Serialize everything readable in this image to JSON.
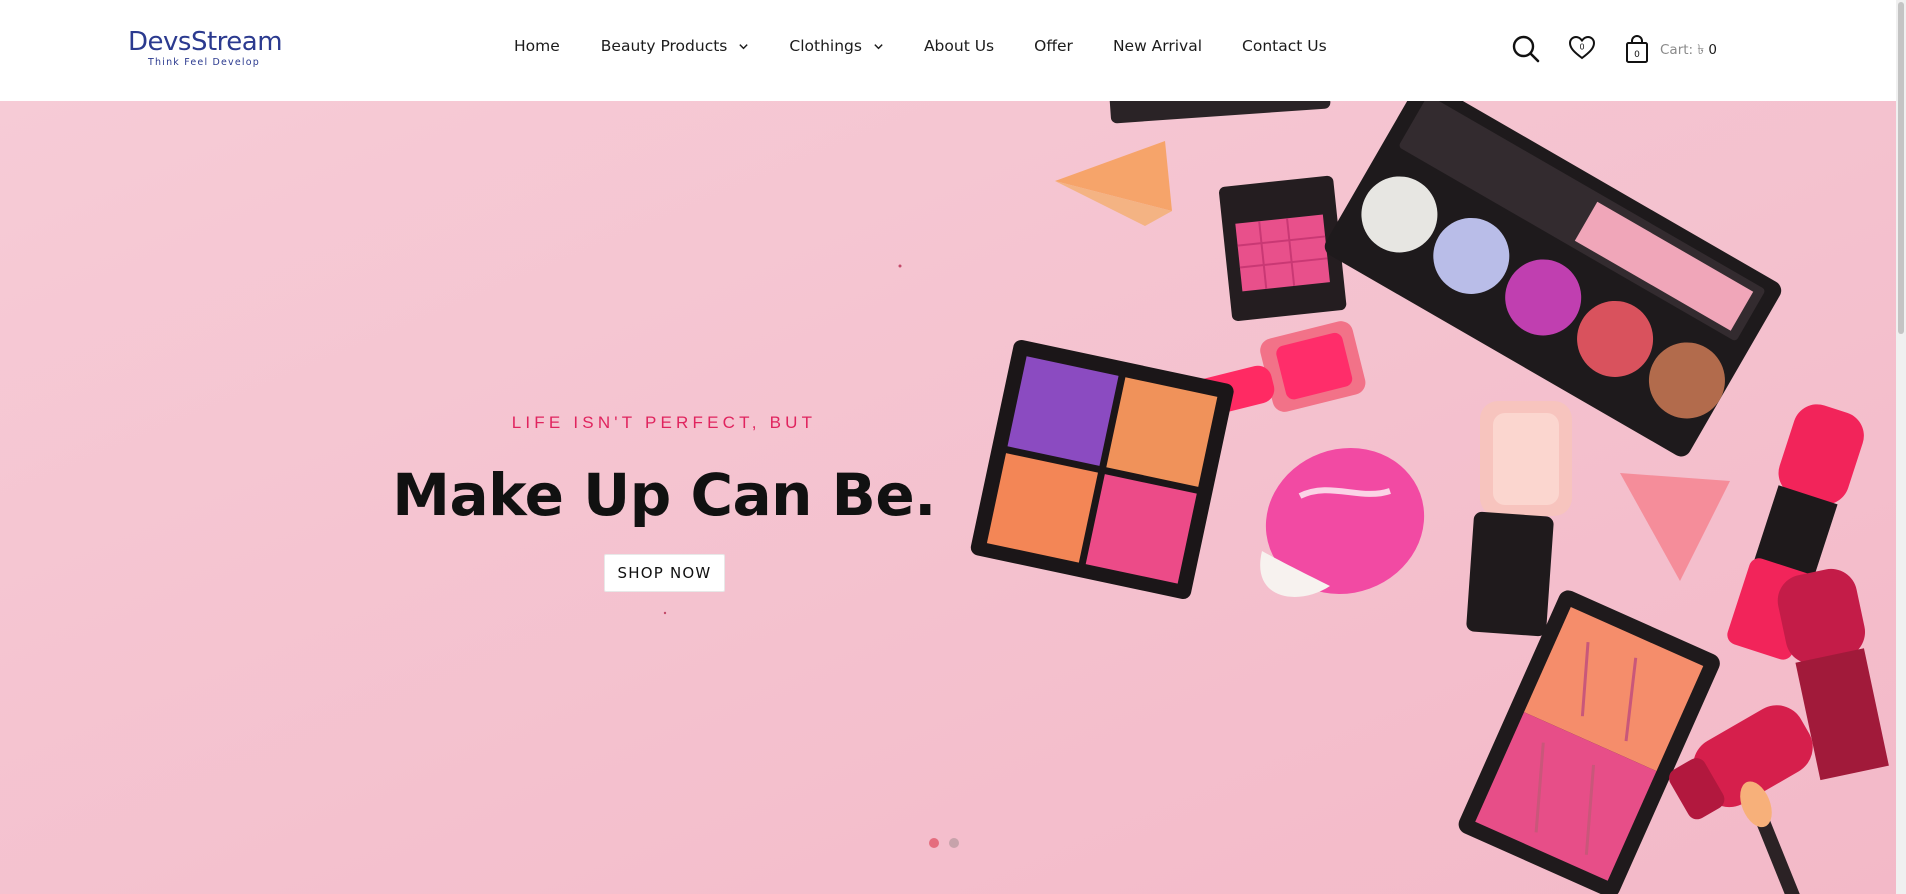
{
  "header": {
    "logo_text": "DevsStream",
    "logo_tagline": "Think Feel Develop",
    "nav": {
      "home": "Home",
      "beauty_products": "Beauty Products",
      "clothings": "Clothings",
      "about": "About Us",
      "offer": "Offer",
      "new_arrival": "New Arrival",
      "contact": "Contact Us"
    },
    "icons": {
      "search": "search-icon",
      "wishlist": "heart-icon",
      "cart": "shopping-bag-icon",
      "dropdown": "chevron-down-icon"
    },
    "bag_badge": "0",
    "cart_label": "Cart: ৳",
    "cart_amount": "0"
  },
  "hero": {
    "subtitle": "LIFE ISN'T PERFECT, BUT",
    "title": "Make Up Can Be.",
    "cta": "SHOP NOW",
    "slides_total": 2,
    "active_slide": 1
  },
  "colors": {
    "hero_bg": "#f5c3cf",
    "accent": "#e0245e",
    "logo": "#2b3a8f",
    "dot_active": "#e56d7e",
    "dot_inactive": "#c7a3ab"
  }
}
